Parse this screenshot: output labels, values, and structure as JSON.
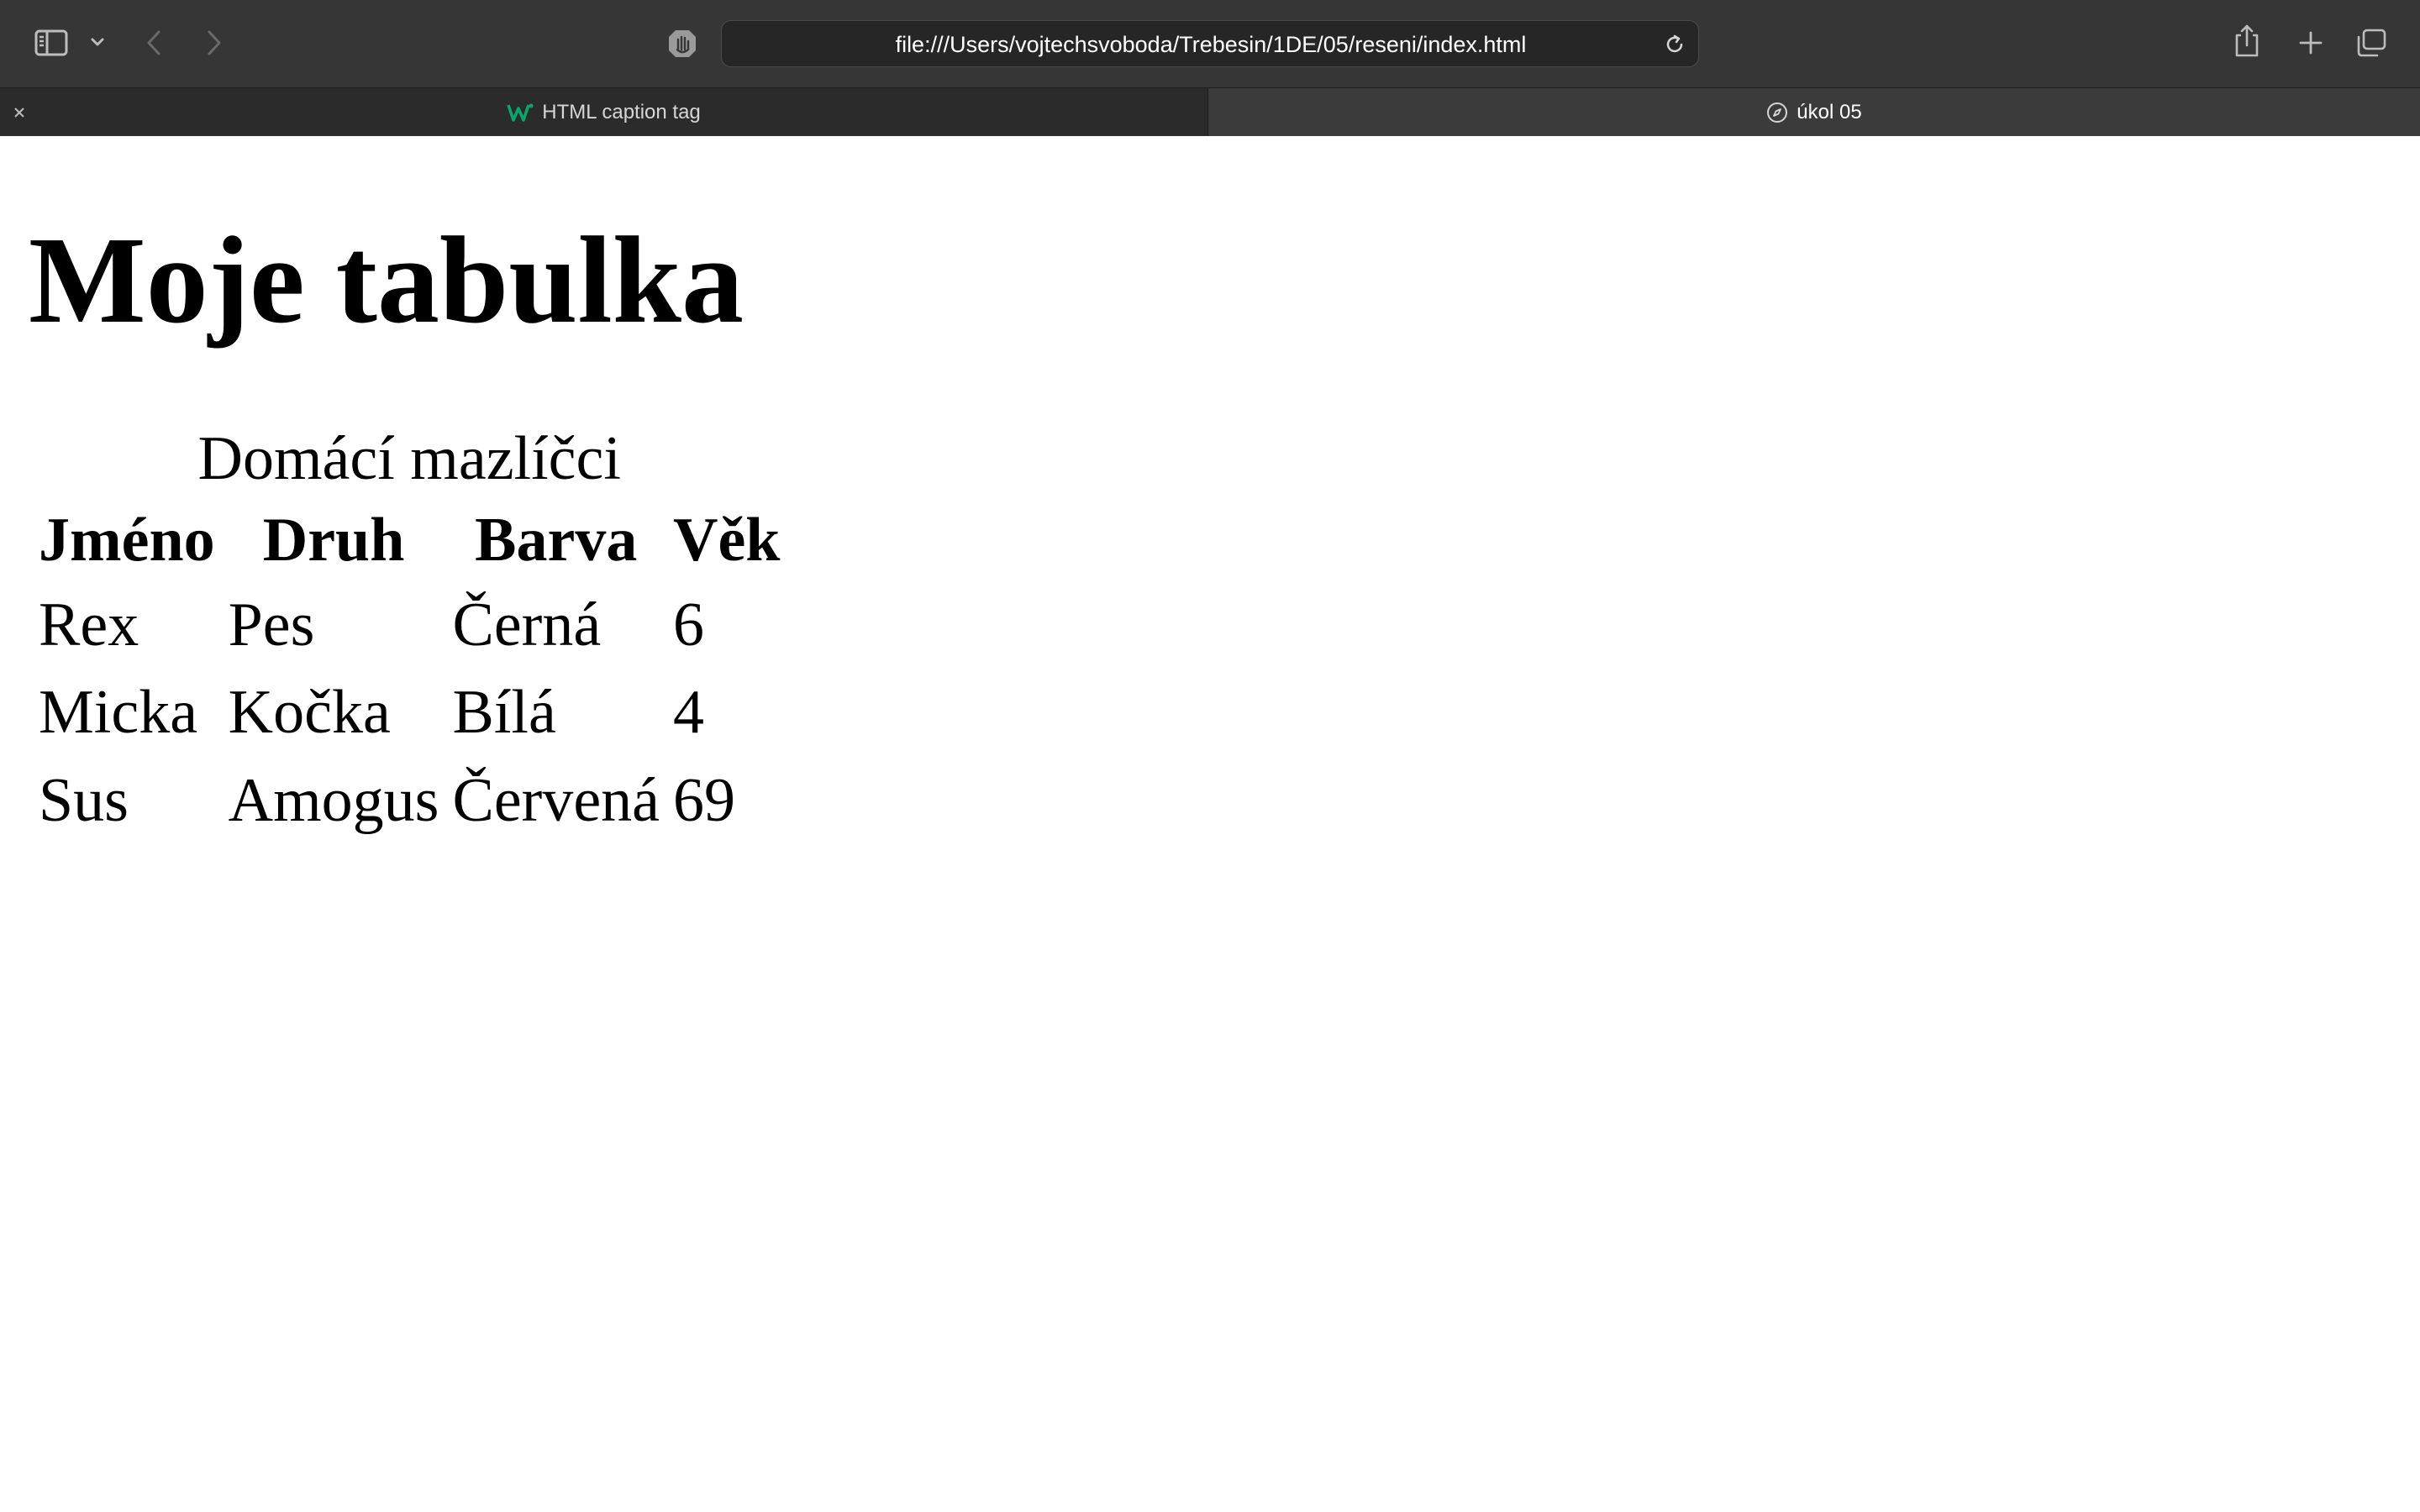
{
  "browser": {
    "url": "file:///Users/vojtechsvoboda/Trebesin/1DE/05/reseni/index.html",
    "tabs": [
      {
        "label": "HTML caption tag",
        "favicon": "w3schools-icon",
        "active": false
      },
      {
        "label": "úkol 05",
        "favicon": "compass-icon",
        "active": true
      }
    ],
    "accent": "#04aa6d",
    "toolbar_bg": "#363636"
  },
  "page": {
    "title": "Moje tabulka",
    "table": {
      "caption": "Domácí mazlíčci",
      "headers": [
        "Jméno",
        "Druh",
        "Barva",
        "Věk"
      ],
      "rows": [
        [
          "Rex",
          "Pes",
          "Černá",
          "6"
        ],
        [
          "Micka",
          "Kočka",
          "Bílá",
          "4"
        ],
        [
          "Sus",
          "Amogus",
          "Červená",
          "69"
        ]
      ]
    }
  }
}
